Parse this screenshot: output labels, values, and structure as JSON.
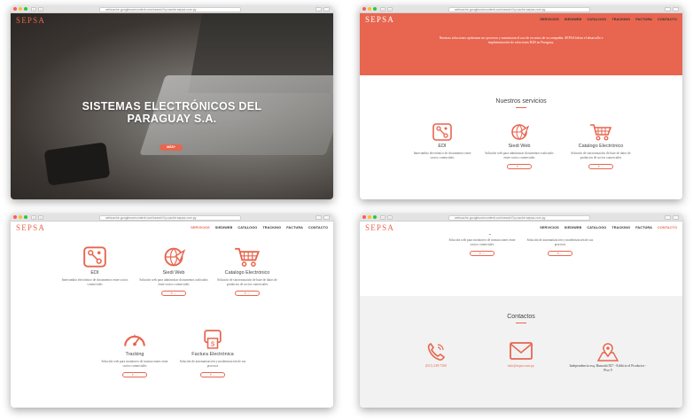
{
  "browser": {
    "url": "webcache.googleusercontent.com/search?q=cache:sepsa.com.py"
  },
  "site": {
    "logo": "SEPSA"
  },
  "nav": {
    "items": [
      "SERVICIOS",
      "SIEDIWEB",
      "CATALOGO",
      "TRACKING",
      "FACTURA",
      "CONTACTO"
    ]
  },
  "hero": {
    "title": "SISTEMAS ELECTRÓNICOS DEL PARAGUAY S.A.",
    "button": "MÁS+"
  },
  "banner": {
    "text": "Nuestras soluciones optimizan sus procesos y maximizan el uso de recursos de su compañía. SEPSA lidera el desarrollo e implementación de soluciones B2B en Paraguay."
  },
  "services": {
    "title": "Nuestros servicios",
    "items": [
      {
        "name": "EDI",
        "desc": "Intercambio electrónico de documentos entre socios comerciales",
        "button": "ir →"
      },
      {
        "name": "Siedi Web",
        "desc": "Solución web para administrar documentos traficados entre socios comerciales",
        "button": "ir →"
      },
      {
        "name": "Catalogo Electrónico",
        "desc": "Solución de sincronización de base de datos de productos de socios comerciales",
        "button": "ir →"
      },
      {
        "name": "Tracking",
        "desc": "Solución web para monitoreo de transacciones entre socios comerciales",
        "button": "ir →"
      },
      {
        "name": "Factura Electrónica",
        "desc": "Solución de automatización y modernización de sus procesos",
        "button": "ir →"
      }
    ]
  },
  "contacts": {
    "title": "Contactos",
    "phone": "(021) 238-7300",
    "email": "info@sepsa.com.py",
    "address": "Independencia esq. Humaitá 827 - Edificio el Productor - Piso 9"
  },
  "colors": {
    "accent": "#e8654f"
  }
}
